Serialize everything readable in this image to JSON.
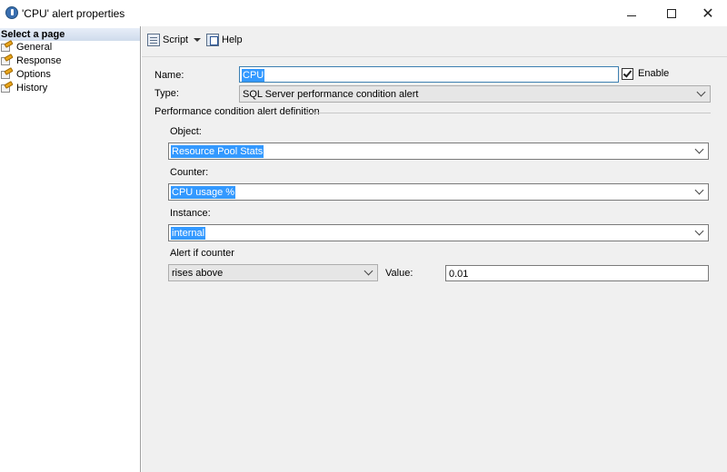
{
  "window": {
    "title": "'CPU' alert properties",
    "minimize_glyph": "—",
    "maximize_glyph": "☐",
    "close_glyph": "✕"
  },
  "sidebar": {
    "header": "Select a page",
    "items": [
      {
        "label": "General",
        "icon": "wrench-page-icon"
      },
      {
        "label": "Response",
        "icon": "wrench-page-icon"
      },
      {
        "label": "Options",
        "icon": "wrench-page-icon"
      },
      {
        "label": "History",
        "icon": "wrench-page-icon"
      }
    ]
  },
  "toolbar": {
    "script_label": "Script",
    "help_label": "Help"
  },
  "form": {
    "name_label": "Name:",
    "name_value": "CPU",
    "enable_label": "Enable",
    "enable_checked": true,
    "type_label": "Type:",
    "type_value": "SQL Server performance condition alert",
    "group_title": "Performance condition alert definition",
    "object_label": "Object:",
    "object_value": "Resource Pool Stats",
    "counter_label": "Counter:",
    "counter_value": "CPU usage %",
    "instance_label": "Instance:",
    "instance_value": "internal",
    "alert_if_label": "Alert if counter",
    "alert_if_value": "rises above",
    "value_label": "Value:",
    "value_value": "0.01"
  },
  "colors": {
    "selection": "#3399ff",
    "sidebar_header": "#cfdbec",
    "panel_bg": "#f0f0f0"
  }
}
